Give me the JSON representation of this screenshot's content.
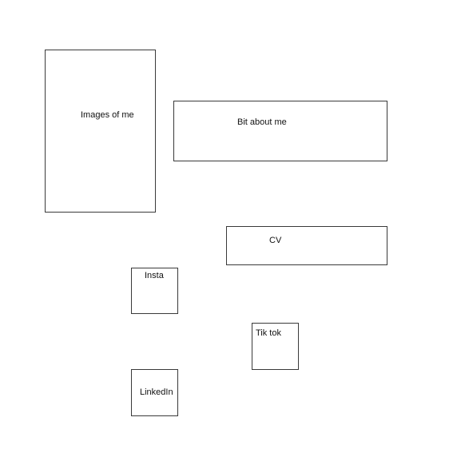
{
  "boxes": {
    "images": {
      "label": "Images of me"
    },
    "about": {
      "label": "Bit about me"
    },
    "cv": {
      "label": "CV"
    },
    "insta": {
      "label": "Insta"
    },
    "tiktok": {
      "label": "Tik tok"
    },
    "linkedin": {
      "label": "LinkedIn"
    }
  }
}
